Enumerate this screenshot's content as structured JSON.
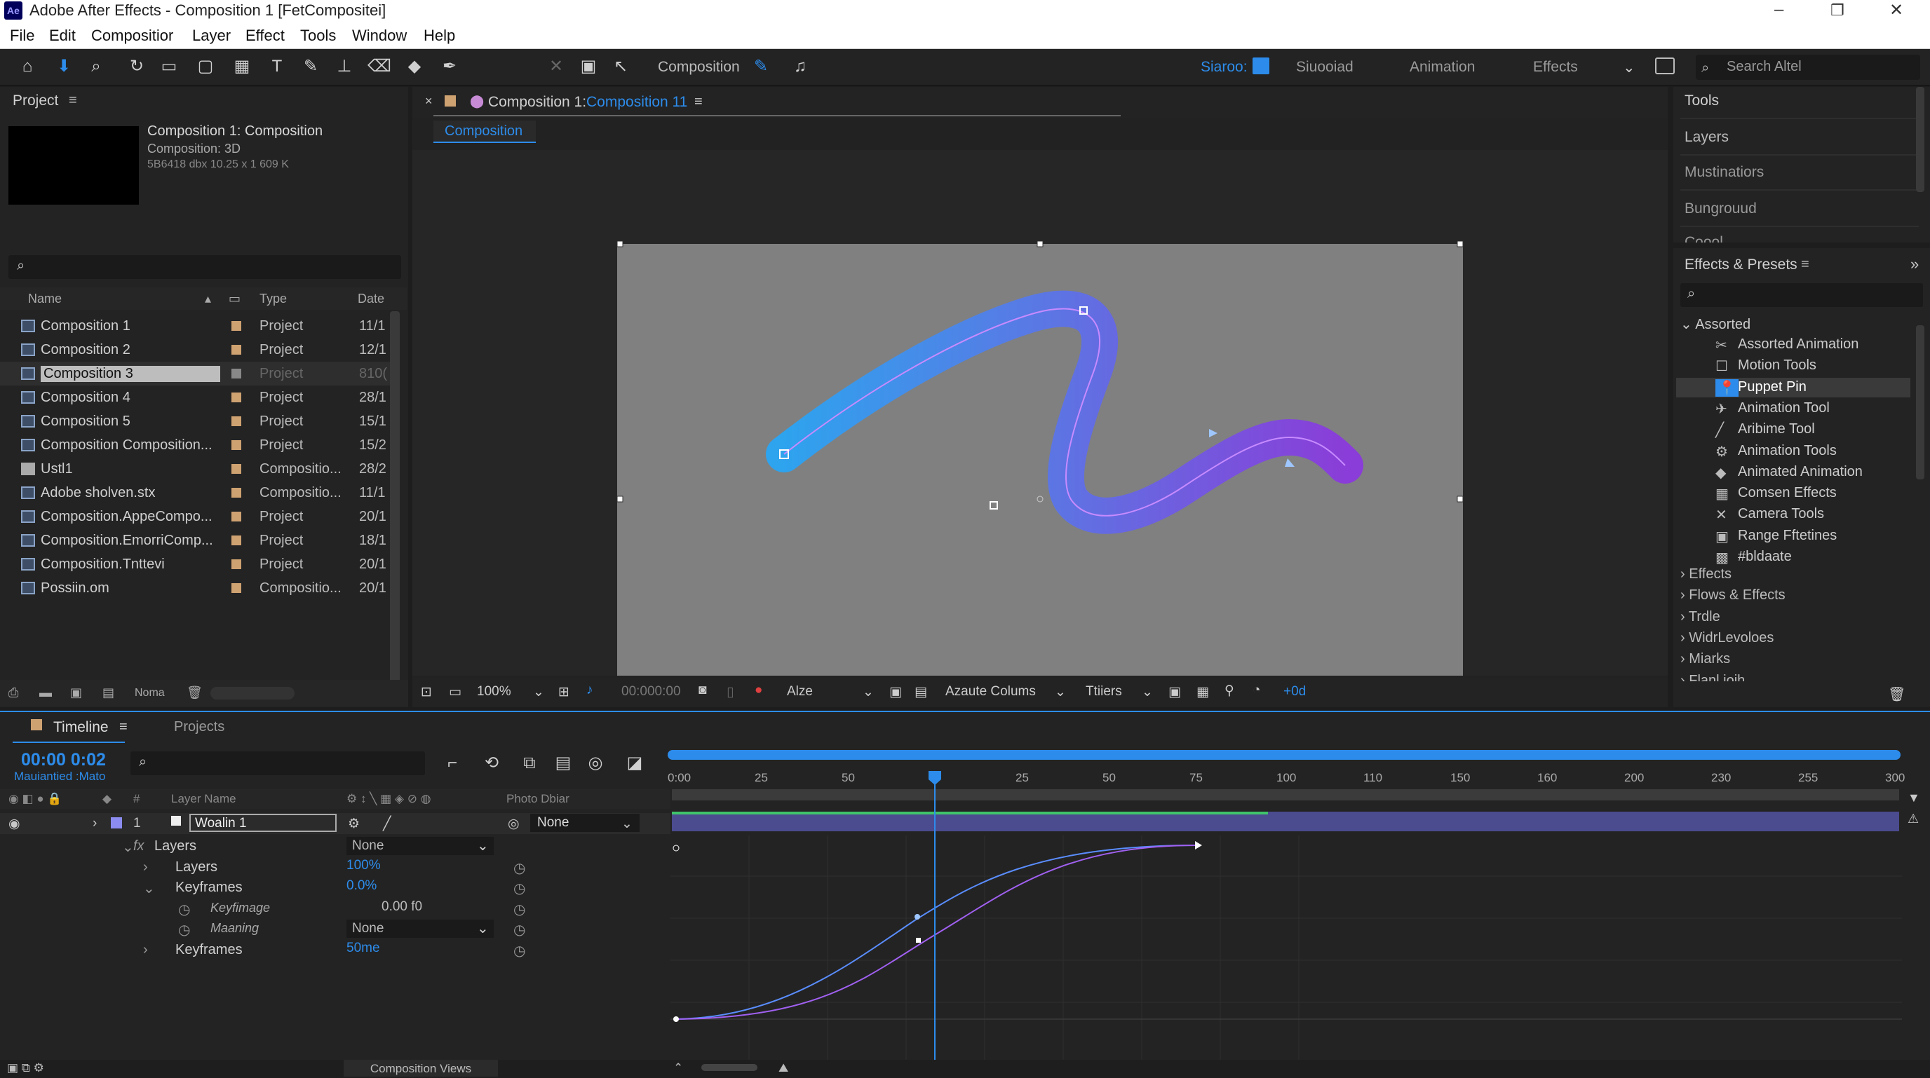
{
  "app": {
    "logo": "Ae",
    "title": "Adobe After Effects - Composition 1 [FetCompositei]"
  },
  "menu": [
    "File",
    "Edit",
    "Compositior",
    "Layer",
    "Effect",
    "Tools",
    "Window",
    "Help"
  ],
  "toolbar": {
    "composition_label": "Composition",
    "workspaces": [
      "Siaroo:",
      "Siuooiad",
      "Animation",
      "Effects"
    ],
    "search_placeholder": "Search Altel"
  },
  "project": {
    "title": "Project",
    "thumb_name": "Composition 1: Composition",
    "thumb_sub1": "Composition: 3D",
    "thumb_sub2": "5B6418 dbx 10.25 x 1 609 K",
    "columns": [
      "Name",
      "Type",
      "Date"
    ],
    "items": [
      {
        "name": "Composition 1",
        "type": "Project",
        "date": "11/1"
      },
      {
        "name": "Composition 2",
        "type": "Project",
        "date": "12/1"
      },
      {
        "name": "Composition 3",
        "type": "Project",
        "date": "810("
      },
      {
        "name": "Composition 4",
        "type": "Project",
        "date": "28/1"
      },
      {
        "name": "Composition 5",
        "type": "Project",
        "date": "15/1"
      },
      {
        "name": "Composition Composition...",
        "type": "Project",
        "date": "15/2"
      },
      {
        "name": "Ustl1",
        "type": "Compositio...",
        "date": "28/2"
      },
      {
        "name": "Adobe sholven.stx",
        "type": "Compositio...",
        "date": "11/1"
      },
      {
        "name": "Composition.AppeCompo...",
        "type": "Project",
        "date": "20/1"
      },
      {
        "name": "Composition.EmorriComp...",
        "type": "Project",
        "date": "18/1"
      },
      {
        "name": "Composition.Tnttevi",
        "type": "Project",
        "date": "20/1"
      },
      {
        "name": "Possiin.om",
        "type": "Compositio...",
        "date": "20/1"
      }
    ],
    "footer_label": "Noma"
  },
  "viewer": {
    "tab_prefix": "Composition 1: ",
    "tab_link": "Composition 11",
    "subtab": "Composition",
    "zoom": "100%",
    "timecode": "00:000:00",
    "layer": "Alze",
    "columns_mode": "Azaute Colums",
    "filter": "Ttiiers",
    "offset": "+0d"
  },
  "right": {
    "items": [
      "Tools",
      "Layers",
      "Mustinatiors",
      "Bungrouud",
      "Coool"
    ],
    "effects_title": "Effects & Presets",
    "tree_header": "Assorted",
    "tree_items": [
      "Assorted Animation",
      "Motion Tools",
      "Puppet Pin",
      "Animation Tool",
      "Aribime Tool",
      "Animation Tools",
      "Animated Animation",
      "Comsen Effects",
      "Camera Tools",
      "Range Fftetines",
      "#bldaate"
    ],
    "sections": [
      "Effects",
      "Flows & Effects",
      "Trdle",
      "WidrLevoloes",
      "Miarks",
      "Flanl.ioih"
    ]
  },
  "timeline": {
    "tab": "Timeline",
    "tab2": "Projects",
    "timecode": "00:00 0:02",
    "sub": "Mauiantied :Mato",
    "ruler": [
      "0:00",
      "25",
      "50",
      "25",
      "50",
      "75",
      "100",
      "110",
      "150",
      "160",
      "200",
      "230",
      "255",
      "300"
    ],
    "col_layer": "Layer Name",
    "col_parent": "Photo Dbiar",
    "layer_num": "1",
    "layer_name": "Woalin 1",
    "parent": "None",
    "props": [
      {
        "label": "Layers",
        "value": "None",
        "indent": 1
      },
      {
        "label": "Layers",
        "value": "100%",
        "indent": 2
      },
      {
        "label": "Keyframes",
        "value": "0.0%",
        "indent": 2
      },
      {
        "label": "Keyfimage",
        "value": "0.00 f0",
        "indent": 3
      },
      {
        "label": "Maaning",
        "value": "None",
        "indent": 3
      },
      {
        "label": "Keyframes",
        "value": "50me",
        "indent": 2
      }
    ],
    "footer": "Composition Views"
  },
  "colors": {
    "accent": "#2d8ceb",
    "bg": "#1d1d1d",
    "panel": "#232323",
    "stroke_start": "#2ea3ee",
    "stroke_end": "#8a3dd8"
  }
}
